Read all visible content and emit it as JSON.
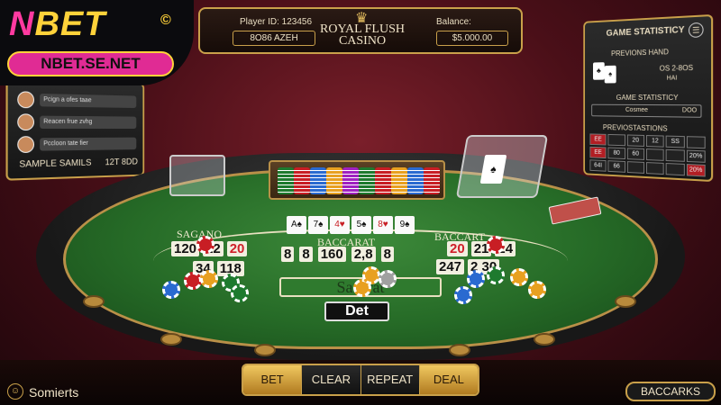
{
  "logo": {
    "text_n": "N",
    "text_bet": "BET",
    "reg": "©",
    "url": "NBET.SE.NET"
  },
  "header": {
    "player_label": "Player ID: 123456",
    "player_value": "8O86 AZEH",
    "title": "ROYAL FLUSH CASINO",
    "balance_label": "Balance:",
    "balance_value": "$5.000.00",
    "crown_icon": "crown-icon"
  },
  "chat": {
    "messages": [
      "Pcign a ofes taae",
      "Reacen frue zvhg",
      "Pccloon tate fier"
    ],
    "footer_label": "SAMPLE SAMILS",
    "footer_value": "12T 8DD"
  },
  "stats": {
    "title": "GAME STATISTICY",
    "prev_hand": "PREVIONS HAND",
    "score": "OS 2-8OS",
    "score2": "HAI",
    "sub_title": "GAME STATISTICY",
    "select_label": "Cosmee",
    "select_value": "DOO",
    "prev2": "PREVIOSTASTIONS",
    "grid": [
      {
        "v": "EE",
        "red": true
      },
      {
        "v": "",
        "red": false
      },
      {
        "v": "20",
        "red": false
      },
      {
        "v": "12",
        "red": false
      },
      {
        "v": "SS",
        "red": false
      },
      {
        "v": "",
        "red": false
      },
      {
        "v": "EE",
        "red": true
      },
      {
        "v": "80",
        "red": false
      },
      {
        "v": "60",
        "red": false
      },
      {
        "v": "",
        "red": false
      },
      {
        "v": "",
        "red": false
      },
      {
        "v": "20%",
        "red": false
      },
      {
        "v": "64I",
        "red": false
      },
      {
        "v": "66",
        "red": false
      },
      {
        "v": "",
        "red": false
      },
      {
        "v": "",
        "red": false
      },
      {
        "v": "",
        "red": false
      },
      {
        "v": "20%",
        "red": true
      }
    ]
  },
  "table": {
    "labels": {
      "left": "SAGANO",
      "center": "BACCARAT",
      "right": "BACCART",
      "payout": "Saccrat",
      "bet": "Det"
    },
    "numbers_left": [
      "12",
      "20",
      "34",
      "118",
      "120"
    ],
    "numbers_center": [
      "8",
      "8",
      "160",
      "2,8",
      "8"
    ],
    "numbers_right": [
      "20",
      "21",
      "24",
      "2 30",
      "247"
    ],
    "dealer_cards": [
      {
        "v": "A♠",
        "red": false
      },
      {
        "v": "7♠",
        "red": false
      },
      {
        "v": "4♥",
        "red": true
      },
      {
        "v": "5♠",
        "red": false
      },
      {
        "v": "8♥",
        "red": true
      },
      {
        "v": "9♠",
        "red": false
      }
    ],
    "chip_colors": [
      "#1e7a2e",
      "#c81e24",
      "#2a6ad0",
      "#e8a020",
      "#a020c0",
      "#1e7a2e",
      "#c81e24",
      "#e8a020",
      "#2a6ad0",
      "#c81e24"
    ]
  },
  "bottom": {
    "user_icon": "user-icon",
    "user_name": "Somierts",
    "buttons": [
      "BET",
      "CLEAR",
      "REPEAT",
      "DEAL"
    ],
    "game_button": "BACCARKS"
  }
}
